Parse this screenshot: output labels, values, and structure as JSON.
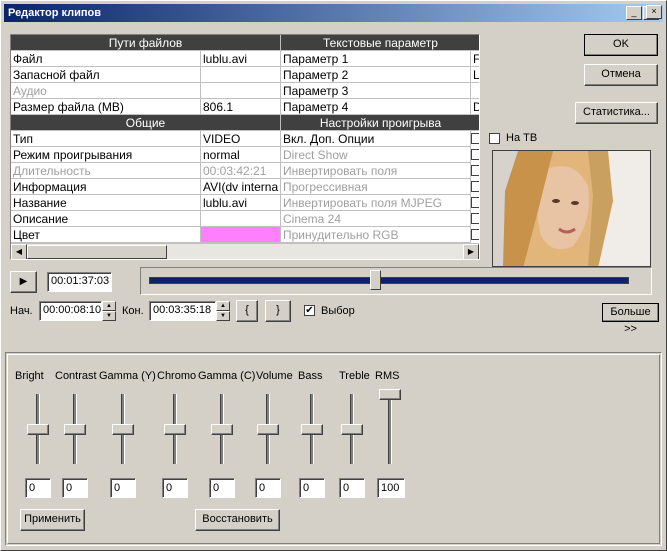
{
  "window": {
    "title": "Редактор клипов",
    "minimize": "_",
    "maximize": "□",
    "close": "×"
  },
  "grid": {
    "files_header": "Пути файлов",
    "text_params_header": "Текстовые параметр",
    "general_header": "Общие",
    "playback_header": "Настройки проигрыва",
    "file_rows": [
      {
        "label": "Файл",
        "value": "lublu.avi",
        "param": "Параметр 1",
        "extra": "F"
      },
      {
        "label": "Запасной файл",
        "value": "",
        "param": "Параметр 2",
        "extra": "L"
      },
      {
        "label": "Аудио",
        "value": "",
        "param": "Параметр 3",
        "extra": ""
      },
      {
        "label": "Размер файла (MB)",
        "value": "806.1",
        "param": "Параметр 4",
        "extra": "D"
      }
    ],
    "general_rows": [
      {
        "label": "Тип",
        "value": "VIDEO",
        "option": "Вкл. Доп. Опции"
      },
      {
        "label": "Режим проигрывания",
        "value": "normal",
        "option": "Direct Show"
      },
      {
        "label": "Длительность",
        "value": "00:03:42:21",
        "option": "Инвертировать поля"
      },
      {
        "label": "Информация",
        "value": "AVI(dv interna",
        "option": "Прогрессивная"
      },
      {
        "label": "Название",
        "value": "lublu.avi",
        "option": "Инвертировать поля MJPEG"
      },
      {
        "label": "Описание",
        "value": "",
        "option": "Cinema 24"
      },
      {
        "label": "Цвет",
        "value": "",
        "option": "Принудительно RGB"
      }
    ],
    "color_value": "#ff80ff"
  },
  "buttons": {
    "ok": "OK",
    "cancel": "Отмена",
    "stats": "Статистика...",
    "more": "Больше >>",
    "apply": "Применить",
    "restore": "Восстановить",
    "mark_in": "{",
    "mark_out": "}"
  },
  "on_tv": {
    "label": "На ТВ",
    "checked": false
  },
  "transport": {
    "time": "00:01:37:03",
    "position": 0.46
  },
  "range": {
    "start_label": "Нач.",
    "start": "00:00:08:10",
    "end_label": "Кон.",
    "end": "00:03:35:18",
    "select_label": "Выбор",
    "select_checked": true
  },
  "eq": [
    {
      "label": "Bright",
      "value": "0",
      "level": 0.5
    },
    {
      "label": "Contrast",
      "value": "0",
      "level": 0.5
    },
    {
      "label": "Gamma (Y)",
      "value": "0",
      "level": 0.5
    },
    {
      "label": "Chromo",
      "value": "0",
      "level": 0.5
    },
    {
      "label": "Gamma (C)",
      "value": "0",
      "level": 0.5
    },
    {
      "label": "Volume",
      "value": "0",
      "level": 0.5
    },
    {
      "label": "Bass",
      "value": "0",
      "level": 0.5
    },
    {
      "label": "Treble",
      "value": "0",
      "level": 0.5
    },
    {
      "label": "RMS",
      "value": "100",
      "level": 1.0
    }
  ]
}
